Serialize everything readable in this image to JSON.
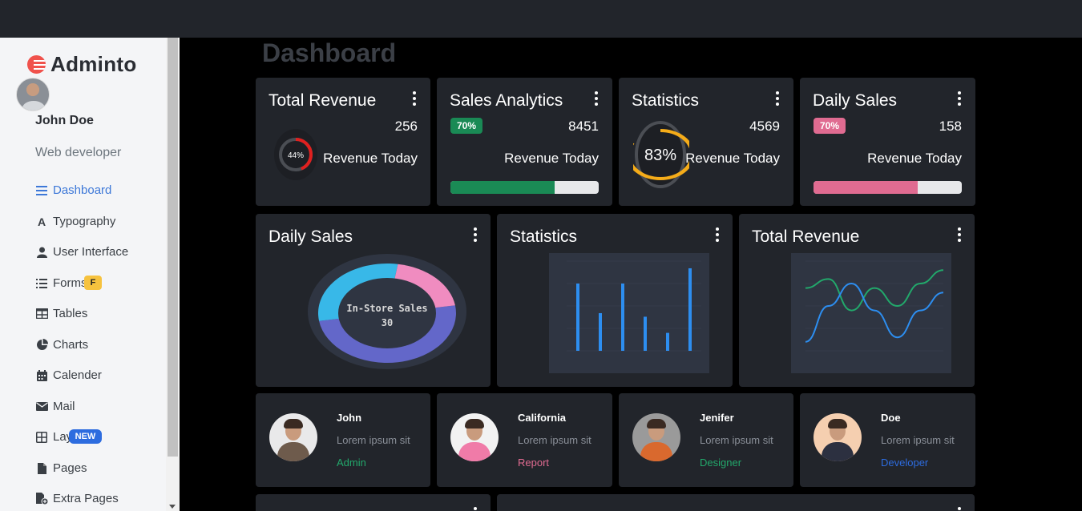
{
  "app": {
    "brand": "Adminto"
  },
  "sidebar": {
    "user_name": "John Doe",
    "user_role": "Web developer",
    "items": [
      {
        "label": "Dashboard",
        "icon": "menu-icon",
        "active": true
      },
      {
        "label": "Typography",
        "icon": "font-icon"
      },
      {
        "label": "User Interface",
        "icon": "user-icon"
      },
      {
        "label": "Forms",
        "icon": "list-icon",
        "badge": "F"
      },
      {
        "label": "Tables",
        "icon": "table-icon"
      },
      {
        "label": "Charts",
        "icon": "pie-chart-icon"
      },
      {
        "label": "Calender",
        "icon": "calendar-icon"
      },
      {
        "label": "Mail",
        "icon": "envelope-icon"
      },
      {
        "label": "Layouts",
        "icon": "grid-icon",
        "badge": "NEW"
      },
      {
        "label": "Pages",
        "icon": "file-icon"
      },
      {
        "label": "Extra Pages",
        "icon": "file-plus-icon"
      }
    ]
  },
  "page": {
    "title": "Dashboard"
  },
  "stats": [
    {
      "title": "Total Revenue",
      "value": "256",
      "subtitle": "Revenue Today",
      "ring_label": "44%",
      "ring_percent": 44,
      "ring_color": "#e0201f"
    },
    {
      "title": "Sales Analytics",
      "value": "8451",
      "subtitle": "Revenue Today",
      "badge": "70%",
      "badge_color": "#1a8a55",
      "progress": 70,
      "bar_color": "#1a8a55"
    },
    {
      "title": "Statistics",
      "value": "4569",
      "subtitle": "Revenue Today",
      "ring_label": "83%",
      "ring_percent": 83,
      "ring_color": "#f5ac19"
    },
    {
      "title": "Daily Sales",
      "value": "158",
      "subtitle": "Revenue Today",
      "badge": "70%",
      "badge_color": "#e06b91",
      "progress": 70,
      "bar_color": "#e06b91"
    }
  ],
  "charts": [
    {
      "title": "Daily Sales"
    },
    {
      "title": "Statistics"
    },
    {
      "title": "Total Revenue"
    }
  ],
  "chart_data": [
    {
      "type": "pie",
      "title": "Daily Sales",
      "center_label": "In-Store Sales",
      "center_value": "30",
      "slices": [
        {
          "value": 50,
          "color": "#6367c9"
        },
        {
          "value": 30,
          "color": "#38b8e8"
        },
        {
          "value": 20,
          "color": "#f08cc0"
        }
      ]
    },
    {
      "type": "bar",
      "title": "Statistics",
      "values": [
        75,
        42,
        75,
        38,
        20,
        92
      ],
      "ylim": [
        0,
        100
      ],
      "color": "#2d8ef0"
    },
    {
      "type": "line",
      "title": "Total Revenue",
      "ylim": [
        0,
        100
      ],
      "series": [
        {
          "values": [
            70,
            80,
            45,
            70,
            50,
            75,
            90
          ],
          "color": "#22a86b"
        },
        {
          "values": [
            10,
            50,
            75,
            45,
            15,
            45,
            65
          ],
          "color": "#2d8ef0"
        }
      ]
    }
  ],
  "people": [
    {
      "name": "John",
      "desc": "Lorem ipsum sit",
      "role": "Admin",
      "role_color": "#22a86b",
      "bg": "#e9e9ea",
      "shirt": "#6e5b4c"
    },
    {
      "name": "California",
      "desc": "Lorem ipsum sit",
      "role": "Report",
      "role_color": "#e06b91",
      "bg": "#f2f2f2",
      "shirt": "#f07ba8"
    },
    {
      "name": "Jenifer",
      "desc": "Lorem ipsum sit",
      "role": "Designer",
      "role_color": "#22a86b",
      "bg": "#9a9a9a",
      "shirt": "#d9692e"
    },
    {
      "name": "Doe",
      "desc": "Lorem ipsum sit",
      "role": "Developer",
      "role_color": "#2d6cdf",
      "bg": "#f5cfb0",
      "shirt": "#2c3040"
    }
  ]
}
